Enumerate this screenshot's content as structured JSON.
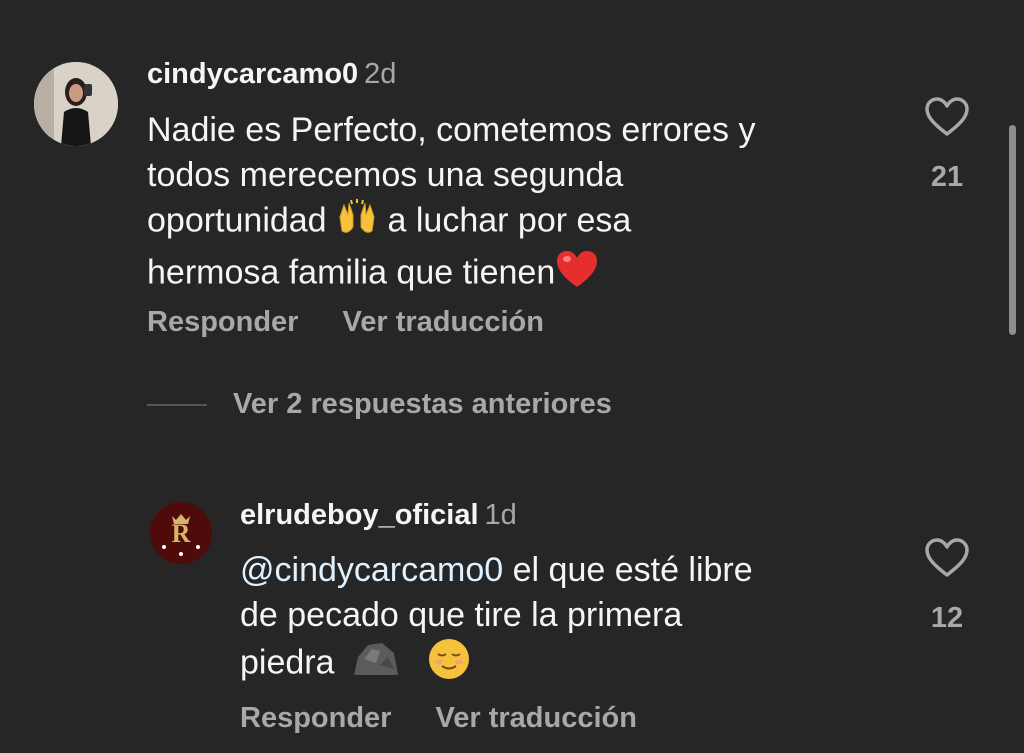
{
  "comments": [
    {
      "username": "cindycarcamo0",
      "time": "2d",
      "lines": [
        "Nadie es Perfecto, cometemos errores y",
        "todos merecemos una segunda",
        "oportunidad",
        "a luchar por esa",
        "hermosa familia que tienen"
      ],
      "likes": "21",
      "reply_label": "Responder",
      "translate_label": "Ver traducción"
    },
    {
      "username": "elrudeboy_oficial",
      "time": "1d",
      "mention": "@cindycarcamo0",
      "lines": [
        "el que esté libre",
        "de pecado que tire la primera",
        "piedra"
      ],
      "likes": "12",
      "reply_label": "Responder",
      "translate_label": "Ver traducción"
    }
  ],
  "view_replies": "Ver 2 respuestas anteriores",
  "icons": {
    "heart": "heart-outline-icon",
    "raised_hands": "raising-hands-emoji",
    "red_heart": "red-heart-emoji",
    "rock": "rock-emoji",
    "relieved_face": "relieved-face-emoji"
  },
  "colors": {
    "background": "#262626",
    "primary_text": "#f5f5f5",
    "secondary_text": "#a8a8a8"
  }
}
